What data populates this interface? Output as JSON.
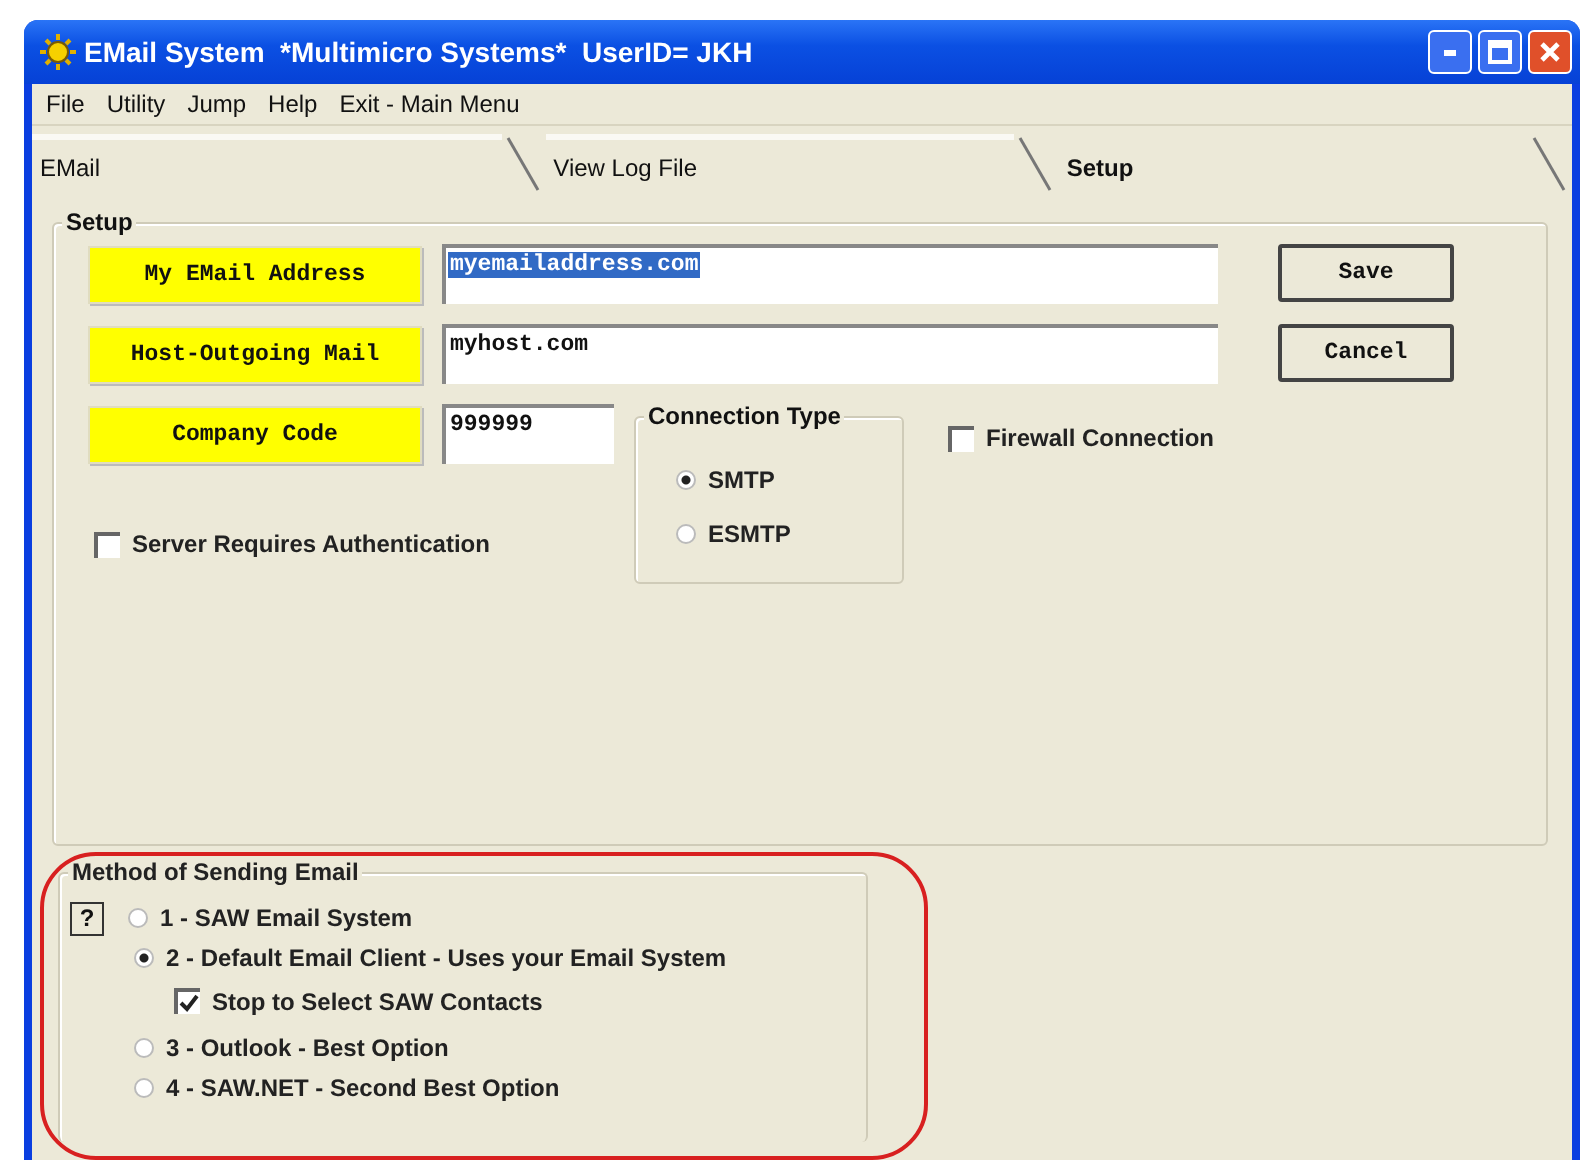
{
  "window": {
    "title": "EMail System  *Multimicro Systems*  UserID= JKH"
  },
  "menu": [
    "File",
    "Utility",
    "Jump",
    "Help",
    "Exit - Main Menu"
  ],
  "tabs": [
    {
      "label": "EMail",
      "selected": false
    },
    {
      "label": "View Log File",
      "selected": false
    },
    {
      "label": "Setup",
      "selected": true
    }
  ],
  "setup": {
    "title": "Setup",
    "fields": [
      {
        "label": "My EMail Address",
        "value": "myemailaddress.com",
        "selected": true
      },
      {
        "label": "Host-Outgoing Mail",
        "value": "myhost.com",
        "selected": false
      },
      {
        "label": "Company Code",
        "value": "999999",
        "selected": false
      }
    ],
    "buttons": [
      "Save",
      "Cancel"
    ],
    "connection_type": {
      "title": "Connection Type",
      "options": [
        {
          "label": "SMTP",
          "selected": true
        },
        {
          "label": "ESMTP",
          "selected": false
        }
      ]
    },
    "firewall": {
      "label": "Firewall Connection",
      "checked": false
    },
    "server_auth": {
      "label": "Server Requires Authentication",
      "checked": false
    }
  },
  "method": {
    "title": "Method of Sending Email",
    "help": "?",
    "options": [
      {
        "kind": "radio",
        "label": "1 - SAW Email System",
        "selected": false
      },
      {
        "kind": "radio",
        "label": "2 - Default Email Client - Uses your Email System",
        "selected": true
      },
      {
        "kind": "checkbox",
        "label": "Stop to Select SAW Contacts",
        "checked": true
      },
      {
        "kind": "radio",
        "label": "3 - Outlook - Best Option",
        "selected": false
      },
      {
        "kind": "radio",
        "label": "4 - SAW.NET - Second Best Option",
        "selected": false
      }
    ]
  }
}
